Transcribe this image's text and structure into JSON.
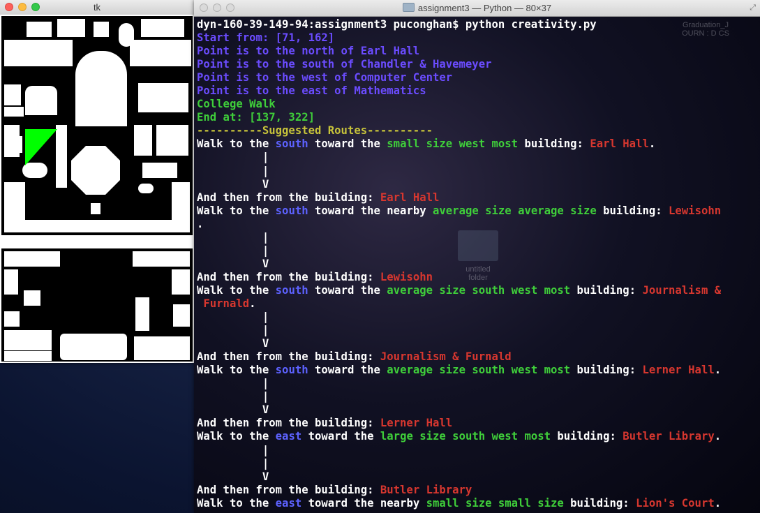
{
  "tk_window": {
    "title": "tk"
  },
  "terminal_window": {
    "title": "assignment3 — Python — 80×37"
  },
  "desktop": {
    "label_graduation": "Graduation_J\nOURN : D CS",
    "label_untitled": "untitled\nfolder"
  },
  "colors": {
    "prompt": "#ffffff",
    "info": "#6b4cff",
    "direction": "#5d62ff",
    "description": "#3fce3a",
    "header": "#c6c23a",
    "building": "#d7372f",
    "map_highlight": "#00ff00"
  },
  "terminal": {
    "lines": [
      [
        {
          "t": "dyn-160-39-149-94:assignment3 puconghan$ python creativity.py",
          "c": "white"
        }
      ],
      [
        {
          "t": "Start from: [71, 162]",
          "c": "blue"
        }
      ],
      [
        {
          "t": "Point is to the north of Earl Hall",
          "c": "blue"
        }
      ],
      [
        {
          "t": "Point is to the south of Chandler & Havemeyer",
          "c": "blue"
        }
      ],
      [
        {
          "t": "Point is to the west of Computer Center",
          "c": "blue"
        }
      ],
      [
        {
          "t": "Point is to the east of Mathematics",
          "c": "blue"
        }
      ],
      [
        {
          "t": "College Walk",
          "c": "green"
        }
      ],
      [
        {
          "t": "End at: [137, 322]",
          "c": "green"
        }
      ],
      [
        {
          "t": "----------Suggested Routes----------",
          "c": "yellow"
        }
      ],
      [
        {
          "t": "Walk to the ",
          "c": "white"
        },
        {
          "t": "south",
          "c": "blue2"
        },
        {
          "t": " toward the ",
          "c": "white"
        },
        {
          "t": "small size west most",
          "c": "green"
        },
        {
          "t": " building: ",
          "c": "white"
        },
        {
          "t": "Earl Hall",
          "c": "red"
        },
        {
          "t": ".",
          "c": "white"
        }
      ],
      [
        {
          "t": "          |",
          "c": "white"
        }
      ],
      [
        {
          "t": "          |",
          "c": "white"
        }
      ],
      [
        {
          "t": "          V",
          "c": "white"
        }
      ],
      [
        {
          "t": "And then from the building: ",
          "c": "white"
        },
        {
          "t": "Earl Hall",
          "c": "red"
        }
      ],
      [
        {
          "t": "Walk to the ",
          "c": "white"
        },
        {
          "t": "south",
          "c": "blue2"
        },
        {
          "t": " toward the nearby ",
          "c": "white"
        },
        {
          "t": "average size average size",
          "c": "green"
        },
        {
          "t": " building: ",
          "c": "white"
        },
        {
          "t": "Lewisohn",
          "c": "red"
        }
      ],
      [
        {
          "t": ".",
          "c": "white"
        }
      ],
      [
        {
          "t": "          |",
          "c": "white"
        }
      ],
      [
        {
          "t": "          |",
          "c": "white"
        }
      ],
      [
        {
          "t": "          V",
          "c": "white"
        }
      ],
      [
        {
          "t": "And then from the building: ",
          "c": "white"
        },
        {
          "t": "Lewisohn",
          "c": "red"
        }
      ],
      [
        {
          "t": "Walk to the ",
          "c": "white"
        },
        {
          "t": "south",
          "c": "blue2"
        },
        {
          "t": " toward the ",
          "c": "white"
        },
        {
          "t": "average size south west most",
          "c": "green"
        },
        {
          "t": " building: ",
          "c": "white"
        },
        {
          "t": "Journalism &",
          "c": "red"
        }
      ],
      [
        {
          "t": " Furnald",
          "c": "red"
        },
        {
          "t": ".",
          "c": "white"
        }
      ],
      [
        {
          "t": "          |",
          "c": "white"
        }
      ],
      [
        {
          "t": "          |",
          "c": "white"
        }
      ],
      [
        {
          "t": "          V",
          "c": "white"
        }
      ],
      [
        {
          "t": "And then from the building: ",
          "c": "white"
        },
        {
          "t": "Journalism & Furnald",
          "c": "red"
        }
      ],
      [
        {
          "t": "Walk to the ",
          "c": "white"
        },
        {
          "t": "south",
          "c": "blue2"
        },
        {
          "t": " toward the ",
          "c": "white"
        },
        {
          "t": "average size south west most",
          "c": "green"
        },
        {
          "t": " building: ",
          "c": "white"
        },
        {
          "t": "Lerner Hall",
          "c": "red"
        },
        {
          "t": ".",
          "c": "white"
        }
      ],
      [
        {
          "t": "          |",
          "c": "white"
        }
      ],
      [
        {
          "t": "          |",
          "c": "white"
        }
      ],
      [
        {
          "t": "          V",
          "c": "white"
        }
      ],
      [
        {
          "t": "And then from the building: ",
          "c": "white"
        },
        {
          "t": "Lerner Hall",
          "c": "red"
        }
      ],
      [
        {
          "t": "Walk to the ",
          "c": "white"
        },
        {
          "t": "east",
          "c": "blue2"
        },
        {
          "t": " toward the ",
          "c": "white"
        },
        {
          "t": "large size south west most",
          "c": "green"
        },
        {
          "t": " building: ",
          "c": "white"
        },
        {
          "t": "Butler Library",
          "c": "red"
        },
        {
          "t": ".",
          "c": "white"
        }
      ],
      [
        {
          "t": "          |",
          "c": "white"
        }
      ],
      [
        {
          "t": "          |",
          "c": "white"
        }
      ],
      [
        {
          "t": "          V",
          "c": "white"
        }
      ],
      [
        {
          "t": "And then from the building: ",
          "c": "white"
        },
        {
          "t": "Butler Library",
          "c": "red"
        }
      ],
      [
        {
          "t": "Walk to the ",
          "c": "white"
        },
        {
          "t": "east",
          "c": "blue2"
        },
        {
          "t": " toward the nearby ",
          "c": "white"
        },
        {
          "t": "small size small size",
          "c": "green"
        },
        {
          "t": " building: ",
          "c": "white"
        },
        {
          "t": "Lion's Court",
          "c": "red"
        },
        {
          "t": ".",
          "c": "white"
        }
      ]
    ]
  }
}
